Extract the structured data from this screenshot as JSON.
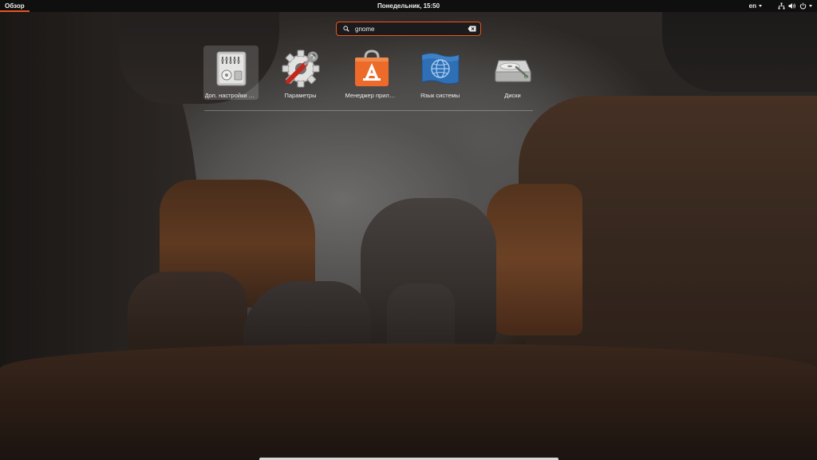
{
  "top_bar": {
    "activities_label": "Обзор",
    "clock": "Понедельник, 15:50",
    "language": "en"
  },
  "search": {
    "value": "gnome",
    "placeholder": ""
  },
  "results": [
    {
      "label": "Доп. настройки GNOME",
      "icon": "gnome-tweaks-icon"
    },
    {
      "label": "Параметры",
      "icon": "settings-icon"
    },
    {
      "label": "Менеджер приложений",
      "icon": "software-center-icon"
    },
    {
      "label": "Язык системы",
      "icon": "language-support-icon"
    },
    {
      "label": "Диски",
      "icon": "disks-icon"
    }
  ],
  "colors": {
    "accent": "#e95420",
    "panel": "#0f0f0f",
    "text": "#eeeeee"
  }
}
